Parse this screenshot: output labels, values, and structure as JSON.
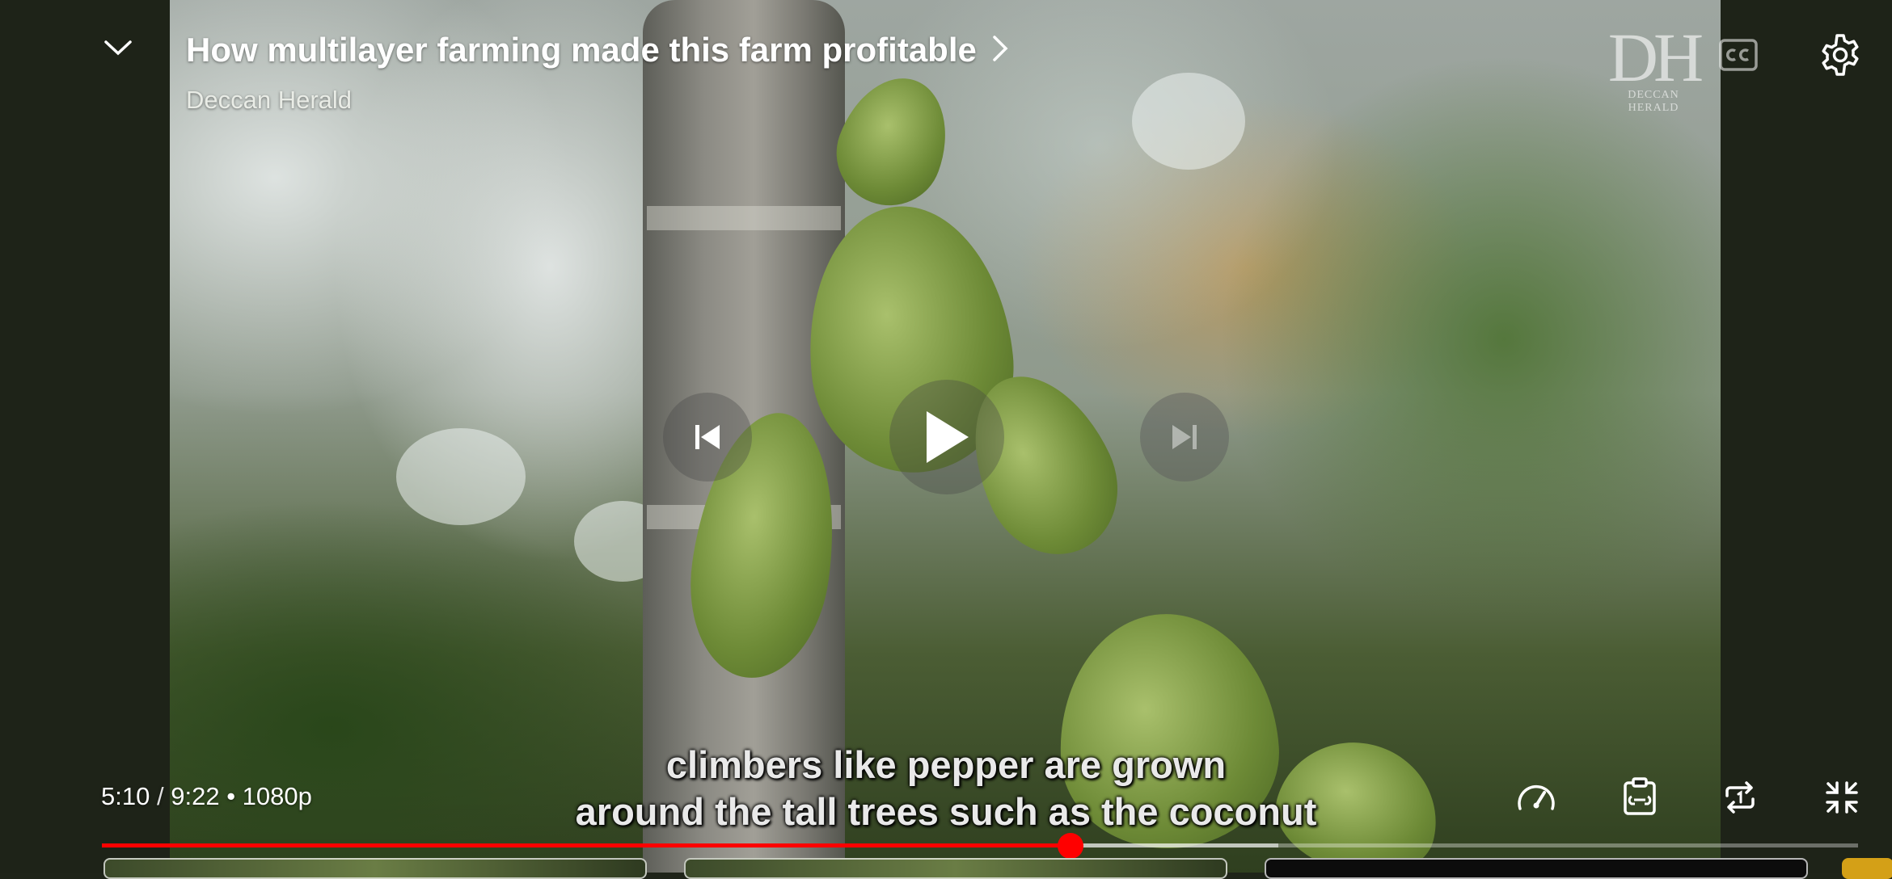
{
  "player": {
    "title": "How multilayer farming made this farm profitable",
    "channel": "Deccan Herald",
    "watermark": {
      "main": "DH",
      "sub": "DECCAN HERALD"
    },
    "current_time": "5:10",
    "separator": "/",
    "duration": "9:22",
    "dot": "•",
    "quality": "1080p",
    "caption_lines": [
      "climbers like pepper are grown",
      "around the tall trees such as the coconut"
    ],
    "progress_fraction": 0.5516,
    "buffered_fraction": 0.67,
    "accent_color": "#ff0000"
  },
  "icons": {
    "collapse": "chevron-down-icon",
    "title_more": "chevron-right-icon",
    "captions": "closed-captions-icon",
    "settings": "gear-icon",
    "previous": "skip-previous-icon",
    "play": "play-icon",
    "next": "skip-next-icon",
    "speed": "speedometer-icon",
    "clip": "clip-icon",
    "loop": "loop-icon",
    "exit_fullscreen": "exit-fullscreen-icon"
  }
}
